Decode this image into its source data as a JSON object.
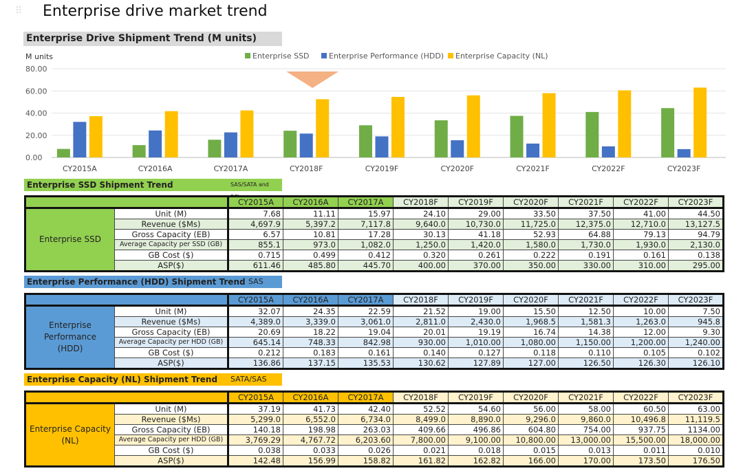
{
  "page_title": "Enterprise drive market trend",
  "colors": {
    "ssd": "#70ad47",
    "hdd": "#4472c4",
    "nl": "#ffc000",
    "marker": "#f4b183"
  },
  "chart_data": {
    "type": "bar",
    "title": "Enterprise Drive  Shipment Trend (M units)",
    "ylabel": "M units",
    "ylim": [
      0,
      80
    ],
    "yticks": [
      "0.00",
      "20.00",
      "40.00",
      "60.00",
      "80.00"
    ],
    "grid": true,
    "legend_position": "top-right",
    "categories": [
      "CY2015A",
      "CY2016A",
      "CY2017A",
      "CY2018F",
      "CY2019F",
      "CY2020F",
      "CY2021F",
      "CY2022F",
      "CY2023F"
    ],
    "series": [
      {
        "name": "Enterprise SSD",
        "color": "#70ad47",
        "values": [
          7.68,
          11.11,
          15.97,
          24.1,
          29.0,
          33.5,
          37.5,
          41.0,
          44.5
        ]
      },
      {
        "name": "Enterprise Performance (HDD)",
        "color": "#4472c4",
        "values": [
          32.07,
          24.35,
          22.59,
          21.52,
          19.0,
          15.5,
          12.5,
          10.0,
          7.5
        ]
      },
      {
        "name": "Enterprise Capacity (NL)",
        "color": "#ffc000",
        "values": [
          37.19,
          41.73,
          42.4,
          52.52,
          54.6,
          56.0,
          58.0,
          60.5,
          63.0
        ]
      }
    ],
    "annotation_marker": {
      "shape": "down-triangle",
      "category": "CY2018F"
    }
  },
  "tables": [
    {
      "title": "Enterprise SSD Shipment Trend",
      "subtitle": "SAS/SATA and PCIe",
      "group_label": "Enterprise SSD",
      "bar_color": "#92d050",
      "tint": "#e2efda",
      "head_actual": "#92d050",
      "head_fc": "#e2efda",
      "years": [
        "CY2015A",
        "CY2016A",
        "CY2017A",
        "CY2018F",
        "CY2019F",
        "CY2020F",
        "CY2021F",
        "CY2022F",
        "CY2023F"
      ],
      "rows": [
        {
          "metric": "Unit (M)",
          "values": [
            "7.68",
            "11.11",
            "15.97",
            "24.10",
            "29.00",
            "33.50",
            "37.50",
            "41.00",
            "44.50"
          ]
        },
        {
          "metric": "Revenue ($Ms)",
          "values": [
            "4,697.9",
            "5,397.2",
            "7,117.8",
            "9,640.0",
            "10,730.0",
            "11,725.0",
            "12,375.0",
            "12,710.0",
            "13,127.5"
          ]
        },
        {
          "metric": "Gross Capacity (EB)",
          "values": [
            "6.57",
            "10.81",
            "17.28",
            "30.13",
            "41.18",
            "52.93",
            "64.88",
            "79.13",
            "94.79"
          ]
        },
        {
          "metric": "Average Capacity per SSD (GB)",
          "values": [
            "855.1",
            "973.0",
            "1,082.0",
            "1,250.0",
            "1,420.0",
            "1,580.0",
            "1,730.0",
            "1,930.0",
            "2,130.0"
          ]
        },
        {
          "metric": "GB Cost ($)",
          "values": [
            "0.715",
            "0.499",
            "0.412",
            "0.320",
            "0.261",
            "0.222",
            "0.191",
            "0.161",
            "0.138"
          ]
        },
        {
          "metric": "ASP($)",
          "values": [
            "611.46",
            "485.80",
            "445.70",
            "400.00",
            "370.00",
            "350.00",
            "330.00",
            "310.00",
            "295.00"
          ]
        }
      ]
    },
    {
      "title": "Enterprise Performance (HDD) Shipment Trend",
      "subtitle": "SAS",
      "group_label": "Enterprise Performance (HDD)",
      "bar_color": "#5b9bd5",
      "tint": "#ddebf7",
      "head_actual": "#5b9bd5",
      "head_fc": "#ddebf7",
      "years": [
        "CY2015A",
        "CY2016A",
        "CY2017A",
        "CY2018F",
        "CY2019F",
        "CY2020F",
        "CY2021F",
        "CY2022F",
        "CY2023F"
      ],
      "rows": [
        {
          "metric": "Unit (M)",
          "values": [
            "32.07",
            "24.35",
            "22.59",
            "21.52",
            "19.00",
            "15.50",
            "12.50",
            "10.00",
            "7.50"
          ]
        },
        {
          "metric": "Revenue ($Ms)",
          "values": [
            "4,389.0",
            "3,339.0",
            "3,061.0",
            "2,811.0",
            "2,430.0",
            "1,968.5",
            "1,581.3",
            "1,263.0",
            "945.8"
          ]
        },
        {
          "metric": "Gross Capacity (EB)",
          "values": [
            "20.69",
            "18.22",
            "19.04",
            "20.01",
            "19.19",
            "16.74",
            "14.38",
            "12.00",
            "9.30"
          ]
        },
        {
          "metric": "Average Capacity per HDD (GB)",
          "values": [
            "645.14",
            "748.33",
            "842.98",
            "930.00",
            "1,010.00",
            "1,080.00",
            "1,150.00",
            "1,200.00",
            "1,240.00"
          ]
        },
        {
          "metric": "GB Cost ($)",
          "values": [
            "0.212",
            "0.183",
            "0.161",
            "0.140",
            "0.127",
            "0.118",
            "0.110",
            "0.105",
            "0.102"
          ]
        },
        {
          "metric": "ASP($)",
          "values": [
            "136.86",
            "137.15",
            "135.53",
            "130.62",
            "127.89",
            "127.00",
            "126.50",
            "126.30",
            "126.10"
          ]
        }
      ]
    },
    {
      "title": "Enterprise Capacity (NL) Shipment Trend",
      "subtitle": "SATA/SAS",
      "group_label": "Enterprise Capacity (NL)",
      "bar_color": "#ffc000",
      "tint": "#fff2cc",
      "head_actual": "#ffc000",
      "head_fc": "#fff2cc",
      "years": [
        "CY2015A",
        "CY2016A",
        "CY2017A",
        "CY2018F",
        "CY2019F",
        "CY2020F",
        "CY2021F",
        "CY2022F",
        "CY2023F"
      ],
      "rows": [
        {
          "metric": "Unit (M)",
          "values": [
            "37.19",
            "41.73",
            "42.40",
            "52.52",
            "54.60",
            "56.00",
            "58.00",
            "60.50",
            "63.00"
          ]
        },
        {
          "metric": "Revenue ($Ms)",
          "values": [
            "5,299.0",
            "6,552.0",
            "6,734.0",
            "8,499.0",
            "8,890.0",
            "9,296.0",
            "9,860.0",
            "10,496.8",
            "11,119.5"
          ]
        },
        {
          "metric": "Gross Capacity (EB)",
          "values": [
            "140.18",
            "198.98",
            "263.03",
            "409.66",
            "496.86",
            "604.80",
            "754.00",
            "937.75",
            "1134.00"
          ]
        },
        {
          "metric": "Average Capacity per HDD (GB)",
          "values": [
            "3,769.29",
            "4,767.72",
            "6,203.60",
            "7,800.00",
            "9,100.00",
            "10,800.00",
            "13,000.00",
            "15,500.00",
            "18,000.00"
          ]
        },
        {
          "metric": "GB Cost ($)",
          "values": [
            "0.038",
            "0.033",
            "0.026",
            "0.021",
            "0.018",
            "0.015",
            "0.013",
            "0.011",
            "0.010"
          ]
        },
        {
          "metric": "ASP($)",
          "values": [
            "142.48",
            "156.99",
            "158.82",
            "161.82",
            "162.82",
            "166.00",
            "170.00",
            "173.50",
            "176.50"
          ]
        }
      ]
    }
  ]
}
